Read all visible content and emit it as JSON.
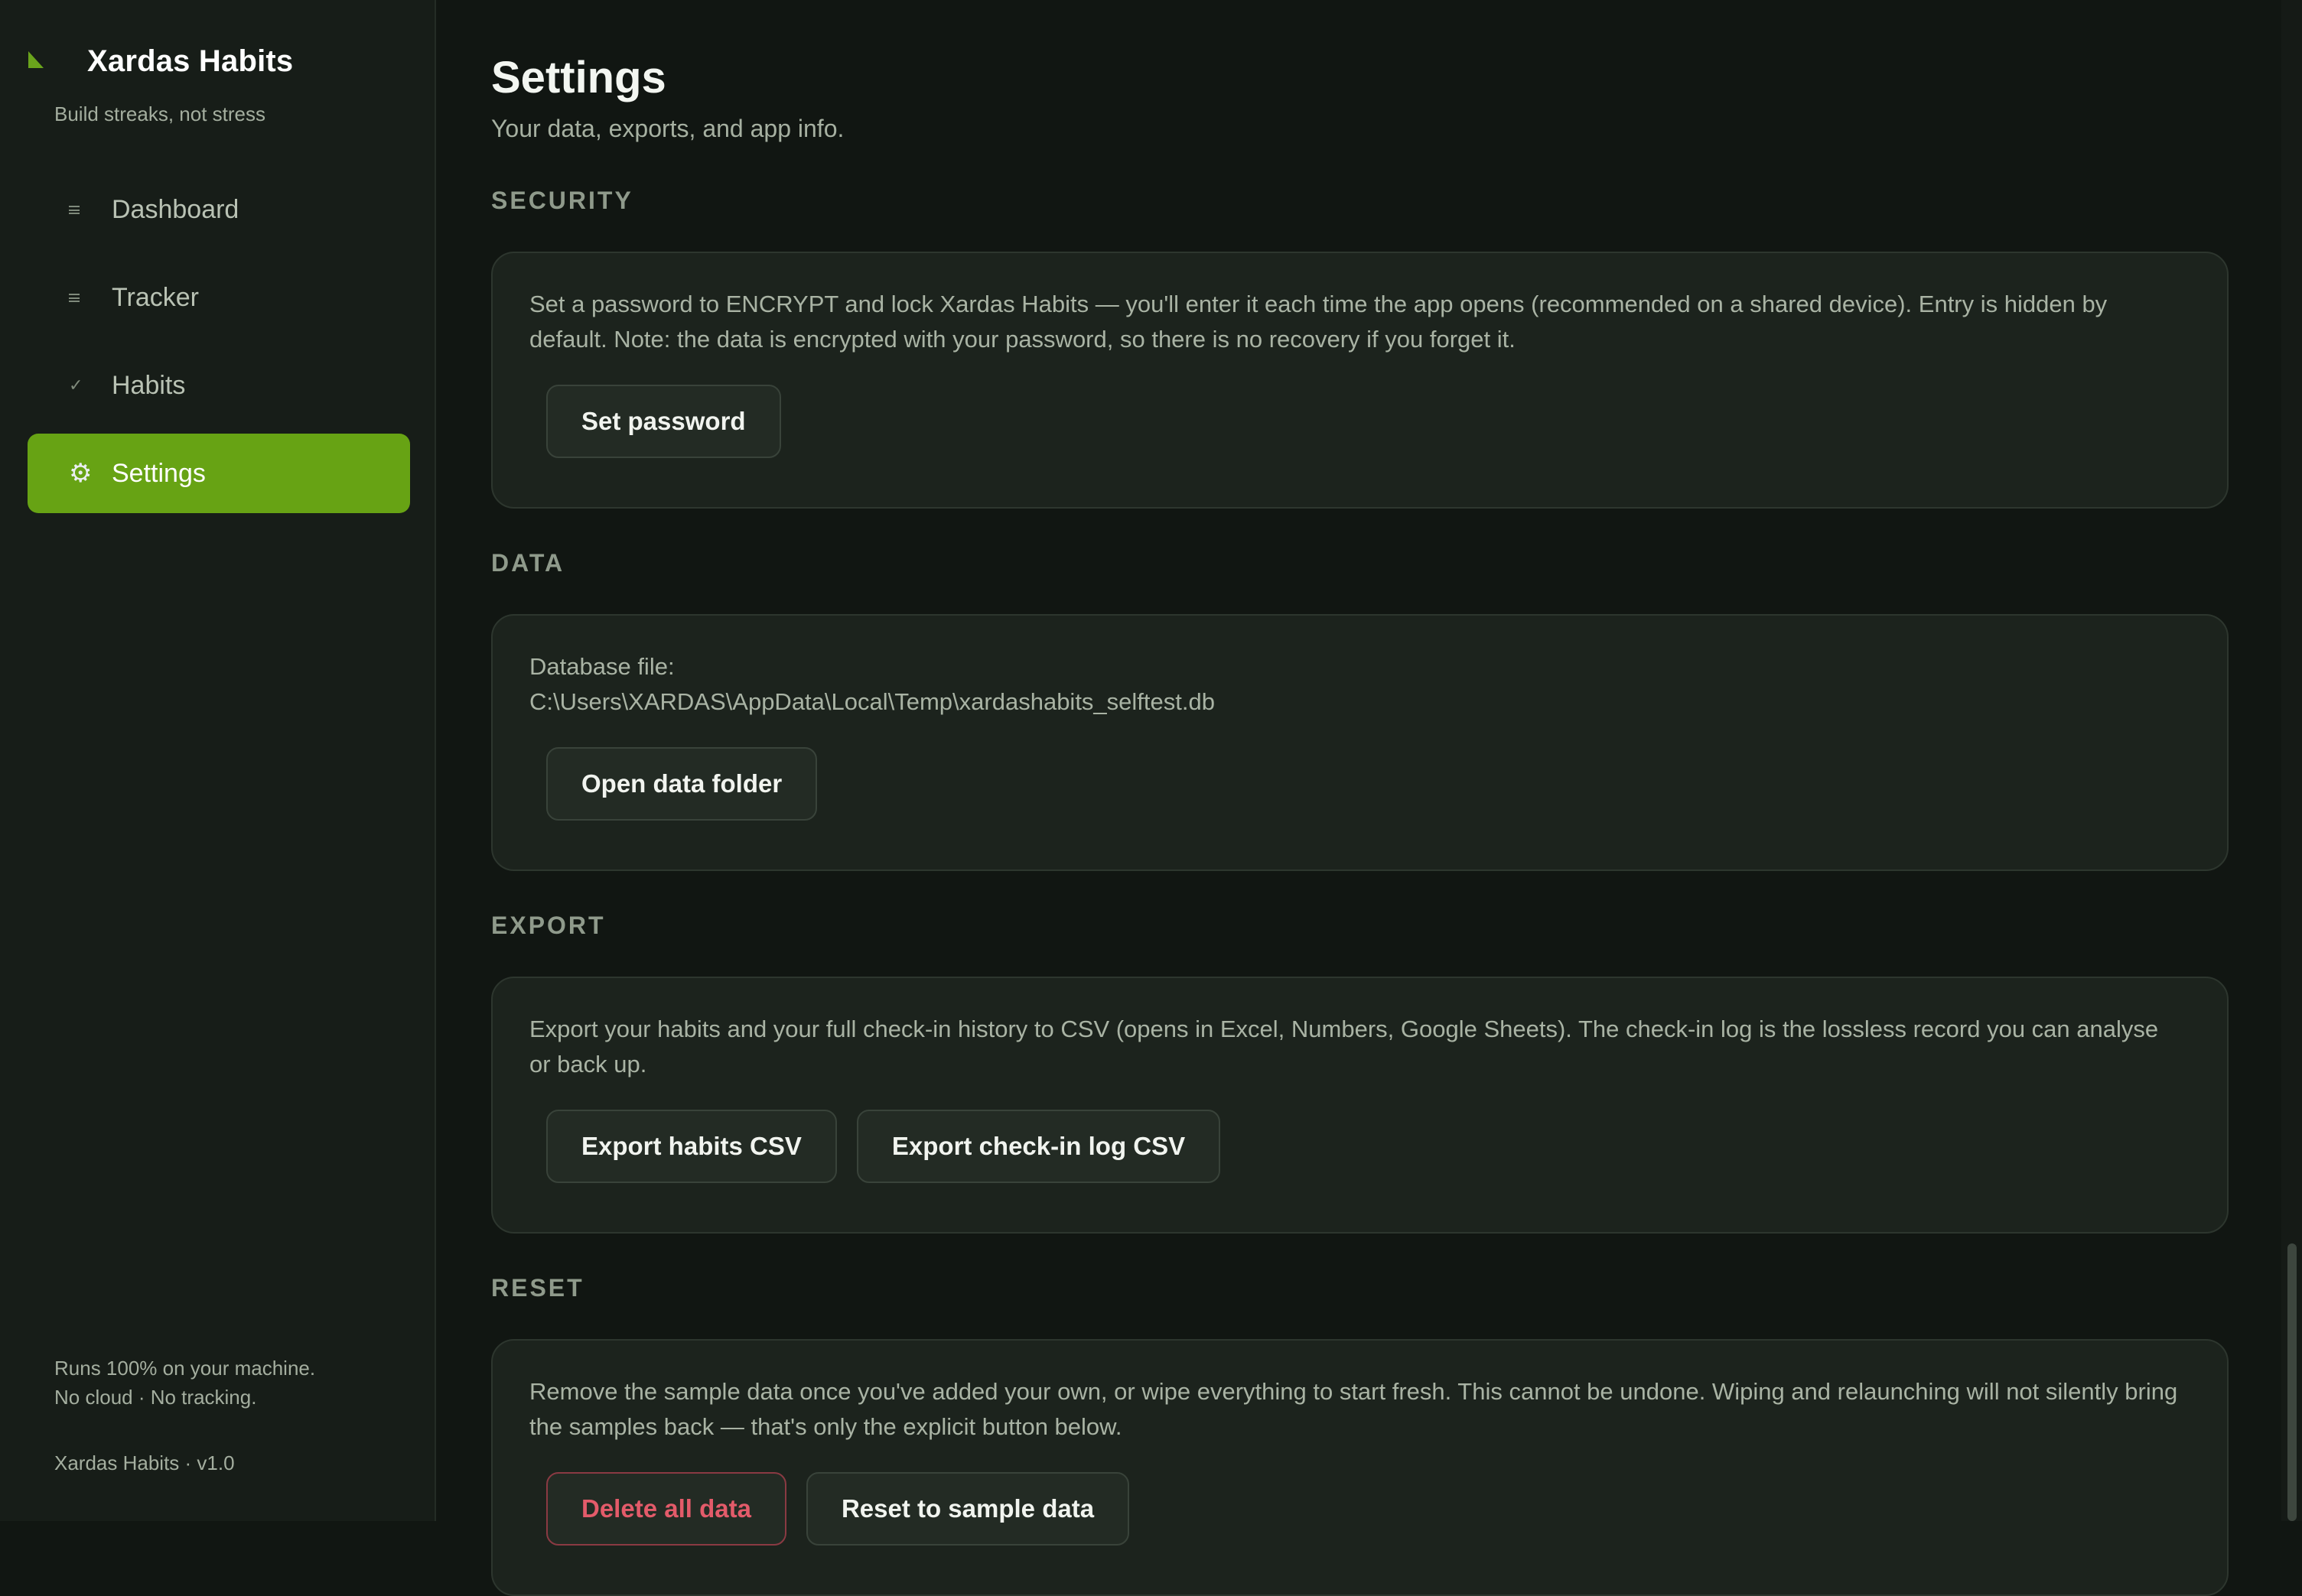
{
  "app": {
    "title": "Xardas Habits",
    "tagline": "Build streaks, not stress",
    "accent_color": "#67a314"
  },
  "sidebar": {
    "items": [
      {
        "label": "Dashboard",
        "icon": "dashboard-icon",
        "active": false
      },
      {
        "label": "Tracker",
        "icon": "tracker-icon",
        "active": false
      },
      {
        "label": "Habits",
        "icon": "check-icon",
        "active": false
      },
      {
        "label": "Settings",
        "icon": "gear-icon",
        "active": true
      }
    ],
    "footer_line1": "Runs 100% on your machine.",
    "footer_line2": "No cloud · No tracking.",
    "version": "Xardas Habits · v1.0"
  },
  "page": {
    "title": "Settings",
    "subtitle": "Your data, exports, and app info."
  },
  "sections": {
    "security": {
      "heading": "SECURITY",
      "text": "Set a password to ENCRYPT and lock Xardas Habits — you'll enter it each time the app opens (recommended on a shared device). Entry is hidden by default. Note: the data is encrypted with your password, so there is no recovery if you forget it.",
      "set_password_label": "Set password"
    },
    "data": {
      "heading": "DATA",
      "db_label": "Database file:",
      "db_path": "C:\\Users\\XARDAS\\AppData\\Local\\Temp\\xardashabits_selftest.db",
      "open_folder_label": "Open data folder"
    },
    "export": {
      "heading": "EXPORT",
      "text": "Export your habits and your full check-in history to CSV (opens in Excel, Numbers, Google Sheets). The check-in log is the lossless record you can analyse or back up.",
      "export_habits_label": "Export habits CSV",
      "export_log_label": "Export check-in log CSV"
    },
    "reset": {
      "heading": "RESET",
      "text": "Remove the sample data once you've added your own, or wipe everything to start fresh. This cannot be undone. Wiping and relaunching will not silently bring the samples back — that's only the explicit button below.",
      "delete_label": "Delete all data",
      "reset_sample_label": "Reset to sample data",
      "danger_color": "#e35b6a"
    }
  }
}
